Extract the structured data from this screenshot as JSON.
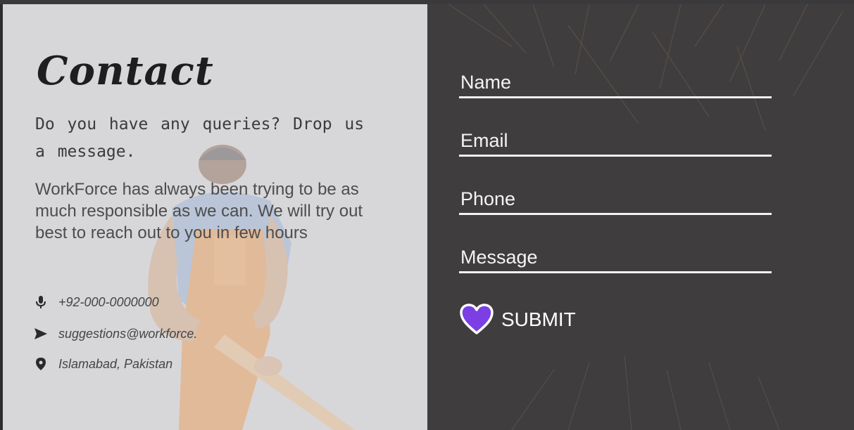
{
  "contact": {
    "title": "Contact",
    "subtitle": "Do you have any queries? Drop us a message.",
    "description": "WorkForce has always been trying to be as much responsible as we can. We will try out best to reach out to you in few hours",
    "phone": "+92-000-0000000",
    "email": "suggestions@workforce.",
    "location": "Islamabad, Pakistan"
  },
  "form": {
    "name_placeholder": "Name",
    "email_placeholder": "Email",
    "phone_placeholder": "Phone",
    "message_placeholder": "Message",
    "submit_label": "SUBMIT"
  },
  "icons": {
    "phone": "microphone-icon",
    "email": "send-icon",
    "location": "location-pin-icon",
    "submit": "heart-icon"
  },
  "colors": {
    "accent": "#7b3fe4",
    "right_panel_bg": "#3f3d3e",
    "left_panel_bg": "#d9d9dc"
  }
}
